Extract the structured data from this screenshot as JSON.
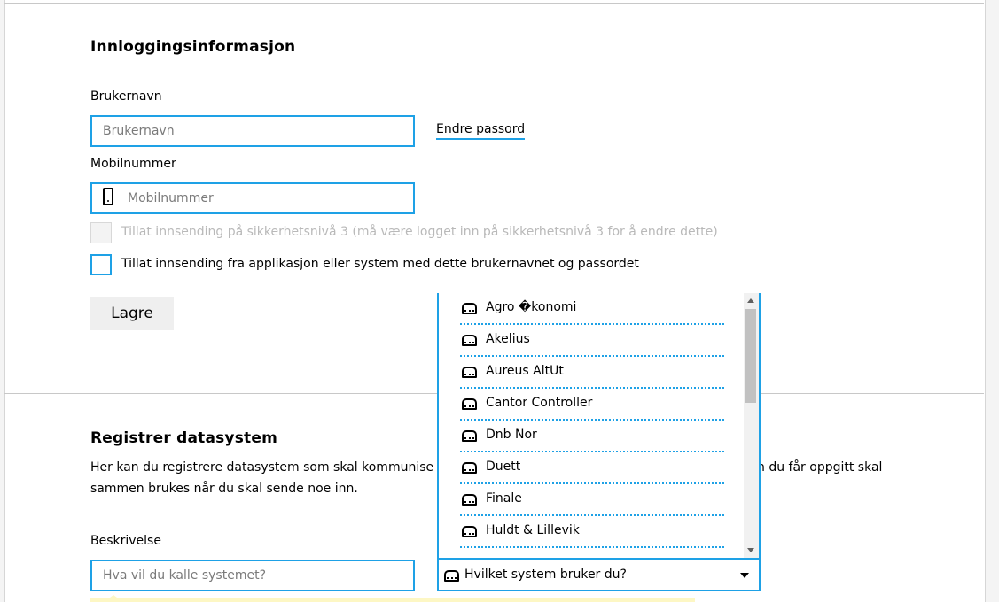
{
  "login": {
    "heading": "Innloggingsinformasjon",
    "username_label": "Brukernavn",
    "username_placeholder": "Brukernavn",
    "change_password_link": "Endre passord",
    "mobile_label": "Mobilnummer",
    "mobile_placeholder": "Mobilnummer",
    "checkbox_security_label": "Tillat innsending på sikkerhetsnivå 3 (må være logget inn på sikkerhetsnivå 3 for å endre dette)",
    "checkbox_app_label": "Tillat innsending fra applikasjon eller system med dette brukernavnet og passordet",
    "save_button": "Lagre"
  },
  "register": {
    "heading": "Registrer datasystem",
    "description_line1_left": "Her kan du registrere datasystem som skal kommunise",
    "description_line1_right": "n du får oppgitt skal",
    "description_line2": "sammen brukes når du skal sende noe inn.",
    "desc_label": "Beskrivelse",
    "desc_placeholder": "Hva vil du kalle systemet?",
    "system_select_placeholder": "Hvilket system bruker du?",
    "system_options": [
      "Agro �konomi",
      "Akelius",
      "Aureus AltUt",
      "Cantor Controller",
      "Dnb Nor",
      "Duett",
      "Finale",
      "Huldt & Lillevik"
    ]
  },
  "colors": {
    "accent": "#1ea1e6",
    "button_bg": "#efefef",
    "hint_bg": "#fdf7c4"
  },
  "icons": [
    "phone-icon",
    "system-icon",
    "chevron-down-icon"
  ]
}
